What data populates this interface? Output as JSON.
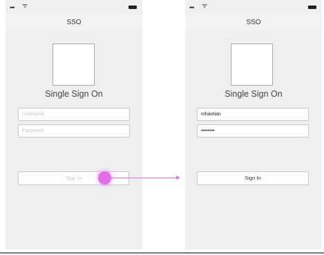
{
  "status_icons": {
    "signal": "•••",
    "wifi": "ᯤ",
    "battery_icon": "battery-icon"
  },
  "screens": [
    {
      "nav_title": "SSO",
      "app_title": "Single Sign On",
      "username": {
        "value": "",
        "placeholder": "Username"
      },
      "password": {
        "value": "",
        "placeholder": "Password"
      },
      "sign_in_label": "Sign In"
    },
    {
      "nav_title": "SSO",
      "app_title": "Single Sign On",
      "username": {
        "value": "mhaotian",
        "placeholder": ""
      },
      "password": {
        "value": "••••••••",
        "placeholder": ""
      },
      "sign_in_label": "Sign In"
    }
  ],
  "colors": {
    "phone_background": "#efefef",
    "tap_indicator": "#e26ee6",
    "field_border": "#c9c9c9"
  }
}
